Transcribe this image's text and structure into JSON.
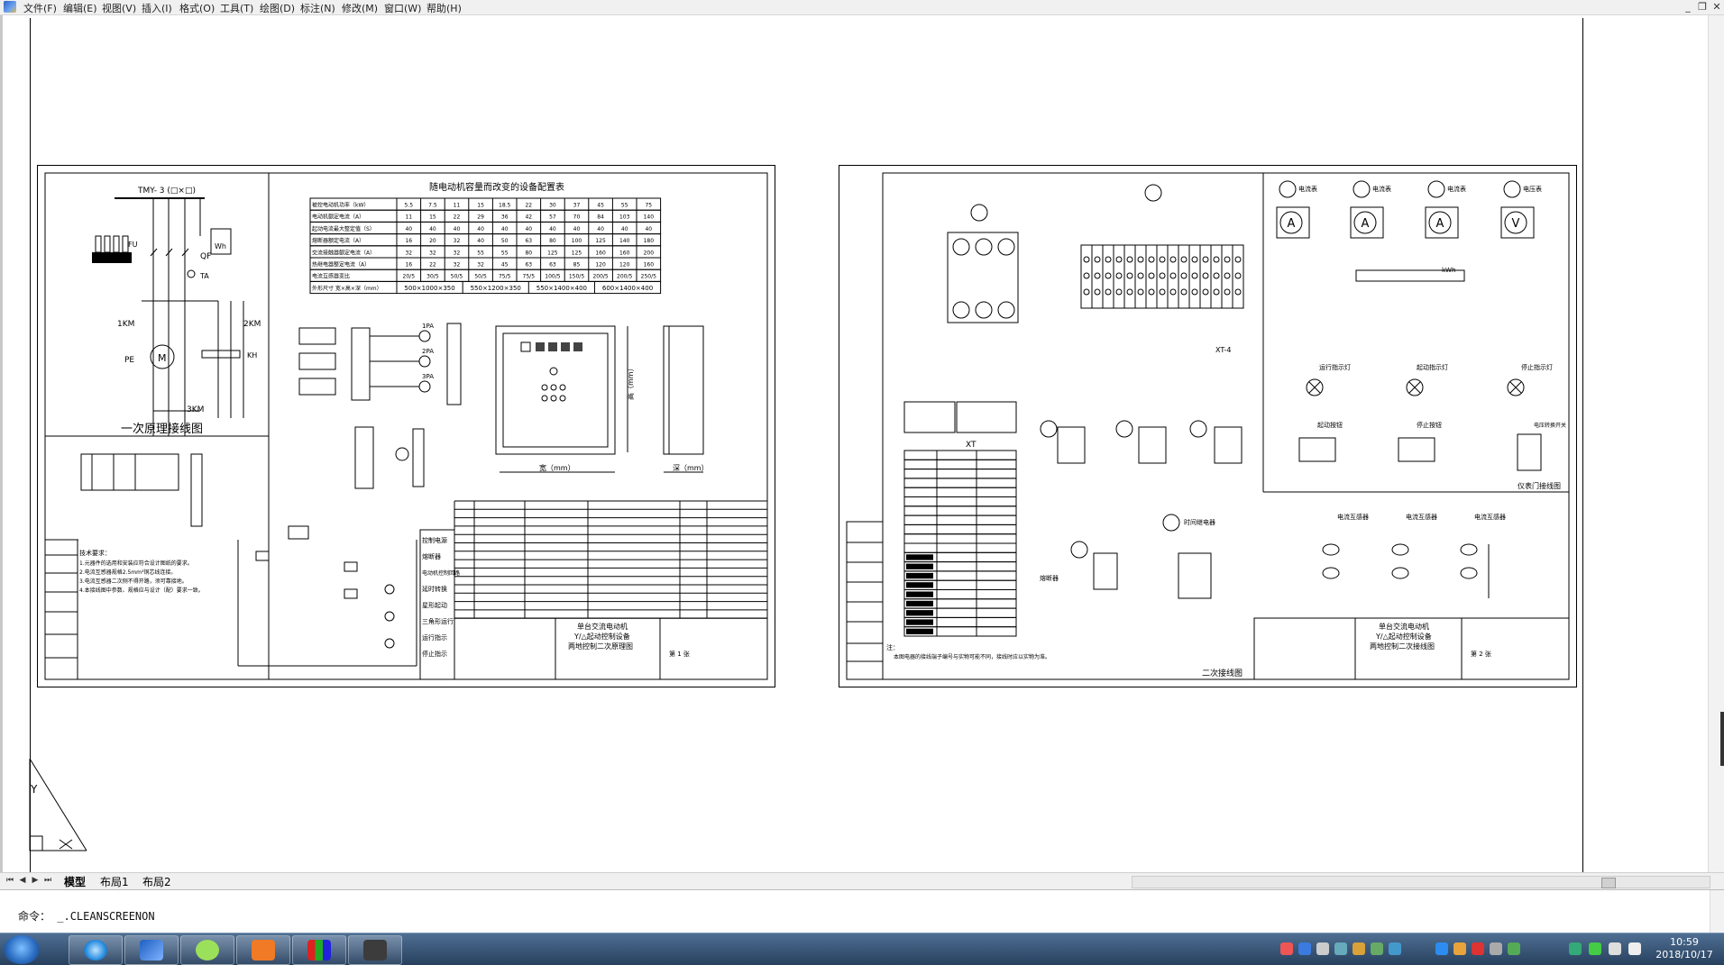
{
  "menu": {
    "items": [
      "文件(F)",
      "编辑(E)",
      "视图(V)",
      "插入(I)",
      "格式(O)",
      "工具(T)",
      "绘图(D)",
      "标注(N)",
      "修改(M)",
      "窗口(W)",
      "帮助(H)"
    ]
  },
  "window_controls": [
    "_",
    "❐",
    "✕"
  ],
  "drawing": {
    "sheet1": {
      "table_title": "随电动机容量而改变的设备配置表",
      "table_rows": [
        [
          "被控电动机功率（kW）",
          "5.5",
          "7.5",
          "11",
          "15",
          "18.5",
          "22",
          "30",
          "37",
          "45",
          "55",
          "75"
        ],
        [
          "电动机额定电流（A）",
          "11",
          "15",
          "22",
          "29",
          "36",
          "42",
          "57",
          "70",
          "84",
          "103",
          "140"
        ],
        [
          "起动电流最大整定值（S）",
          "40",
          "40",
          "40",
          "40",
          "40",
          "40",
          "40",
          "40",
          "40",
          "40",
          "40"
        ],
        [
          "熔断器额定电流（A）",
          "16",
          "20",
          "32",
          "40",
          "50",
          "63",
          "80",
          "100",
          "125",
          "140",
          "180"
        ],
        [
          "交流接触器额定电流（A）",
          "32",
          "32",
          "32",
          "55",
          "55",
          "80",
          "125",
          "125",
          "160",
          "160",
          "200"
        ],
        [
          "热继电器整定电流（A）",
          "16",
          "22",
          "32",
          "32",
          "45",
          "63",
          "63",
          "85",
          "120",
          "120",
          "160"
        ],
        [
          "电流互感器变比",
          "20/5",
          "30/5",
          "50/5",
          "50/5",
          "75/5",
          "75/5",
          "100/5",
          "150/5",
          "200/5",
          "200/5",
          "250/5"
        ],
        [
          "外形尺寸  宽×高×深（mm）",
          "500×1000×350",
          "550×1200×350",
          "550×1400×400",
          "600×1400×400"
        ]
      ],
      "mains_label": "TMY- 3 (□×□)",
      "primary_caption": "一次原理接线图",
      "labels": {
        "km1": "1KM",
        "km2": "2KM",
        "km3": "3KM",
        "kh": "KH",
        "pe": "PE",
        "qf": "QF",
        "ta": "TA",
        "wh": "Wh",
        "fu": "FU",
        "motor": "M"
      },
      "dim_labels": {
        "width": "宽（mm）",
        "height": "高（mm）",
        "depth": "深（mm）"
      },
      "ammeters": [
        "1PA",
        "2PA",
        "3PA"
      ],
      "ctrl_labels": [
        "控制电源",
        "熔断器",
        "电动机控制回路",
        "延时转换",
        "星形起动",
        "三角形运行",
        "运行指示",
        "停止指示"
      ],
      "notes_title": "技术要求：",
      "notes_lines": [
        "1.元器件的选用和安装应符合设计图纸的要求。",
        "2.电流互感器规格2.5mm²铜芯线连接。",
        "3.电流互感器二次侧不得开路，须可靠接地。",
        "4.本接线图中参数、规格应与设计（配）要求一致。"
      ],
      "title_block": {
        "title_line1": "单台交流电动机",
        "title_line2": "Y/△起动控制设备",
        "title_line3": "两地控制二次原理图",
        "sheet_info": "第 1 张"
      }
    },
    "sheet2": {
      "terminal_strip_label": "XT",
      "xt4_label": "XT-4",
      "kwh_label": "kWh",
      "meter_names": [
        "电流表",
        "电流表",
        "电流表",
        "电压表"
      ],
      "meter_symbols": [
        "A",
        "A",
        "A",
        "V"
      ],
      "indicator_labels": [
        "运行指示灯",
        "起动指示灯",
        "停止指示灯"
      ],
      "button_labels": [
        "起动按钮",
        "停止按钮",
        "电压转换开关"
      ],
      "ct_labels": [
        "电流互感器",
        "电流互感器",
        "电流互感器"
      ],
      "panel_caption": "仪表门接线图",
      "secondary_caption": "二次接线图",
      "fuse_caption": "熔断器",
      "relay_caption": "时间继电器",
      "note_line1": "注：",
      "note_line2": "本图电器的接线端子编号与实物可能不同，接线时应以实物为准。",
      "title_block": {
        "title_line1": "单台交流电动机",
        "title_line2": "Y/△起动控制设备",
        "title_line3": "两地控制二次接线图",
        "sheet_info": "第 2 张"
      }
    },
    "ucs_label": "Y"
  },
  "layout_tabs": [
    "模型",
    "布局1",
    "布局2"
  ],
  "command": {
    "prompt": "命令：",
    "text": " _.CLEANSCREENON"
  },
  "taskbar": {
    "clock_time": "10:59",
    "clock_date": "2018/10/17"
  }
}
